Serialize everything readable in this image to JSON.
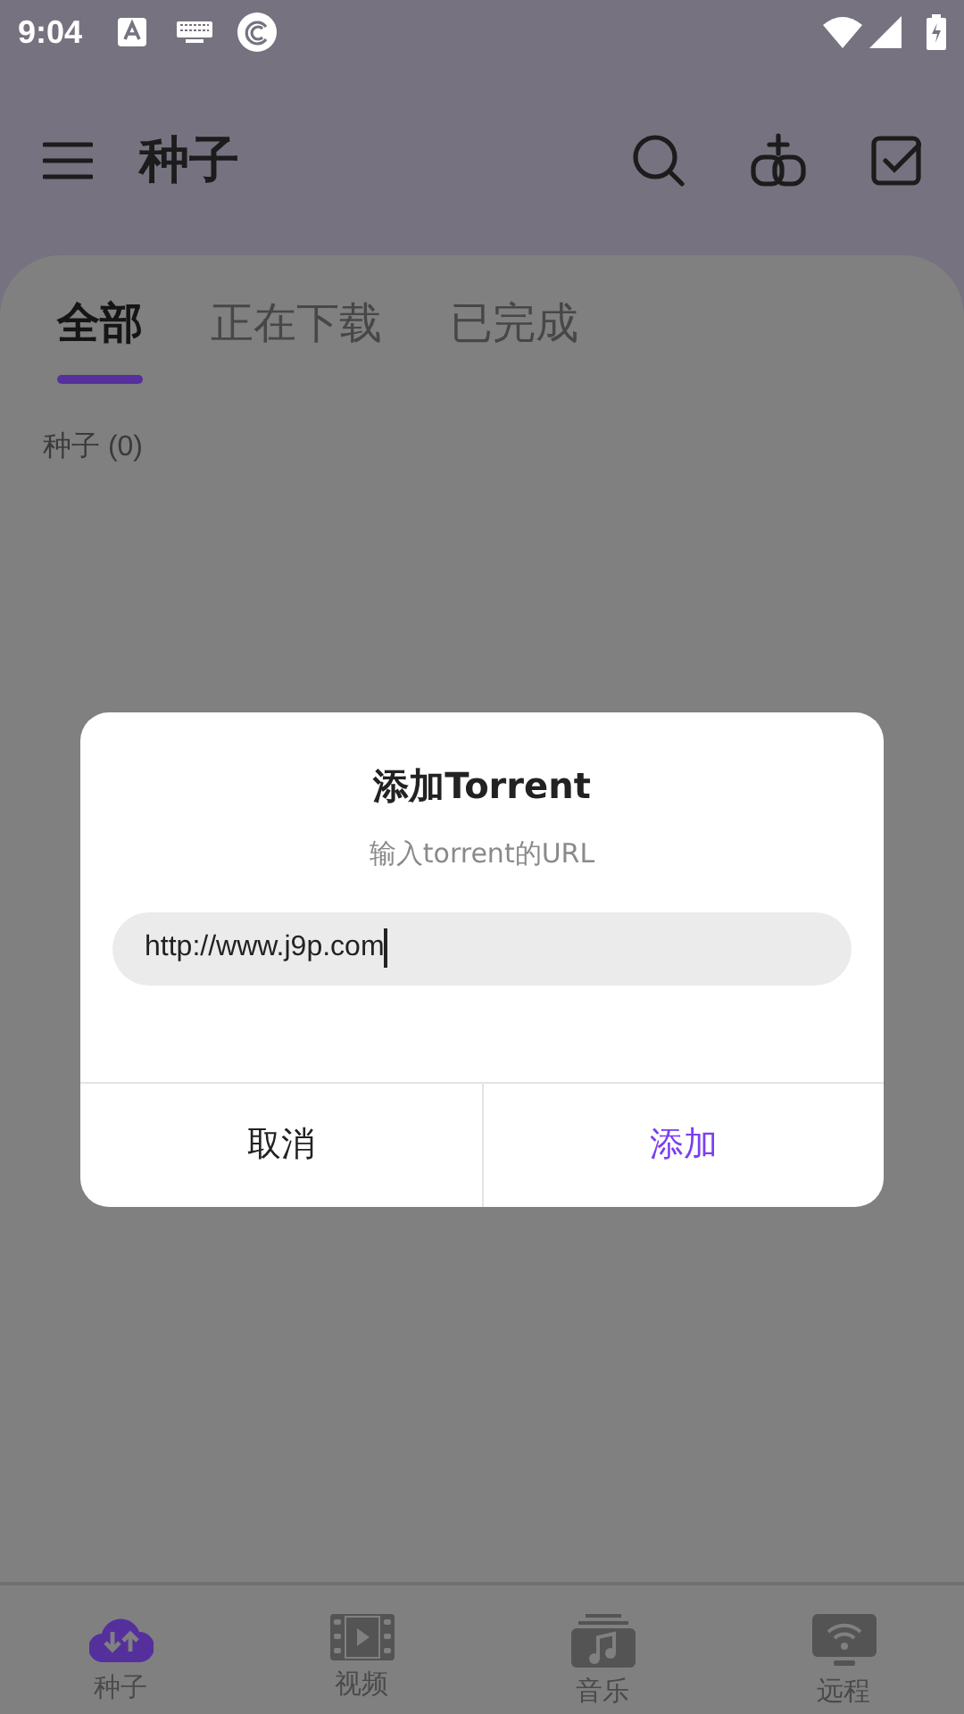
{
  "status_bar": {
    "time": "9:04"
  },
  "app_bar": {
    "title": "种子"
  },
  "tabs": [
    {
      "label": "全部",
      "selected": true
    },
    {
      "label": "正在下载",
      "selected": false
    },
    {
      "label": "已完成",
      "selected": false
    }
  ],
  "list_header": "种子 (0)",
  "dialog": {
    "title": "添加Torrent",
    "subtitle": "输入torrent的URL",
    "input": {
      "value": "http://www.j9p.com",
      "focused": true
    },
    "buttons": [
      {
        "label": "取消",
        "kind": "cancel"
      },
      {
        "label": "添加",
        "kind": "primary"
      }
    ]
  },
  "bottom_nav": [
    {
      "label": "种子",
      "kind": "torrent",
      "selected": true
    },
    {
      "label": "视频",
      "kind": "video",
      "selected": false
    },
    {
      "label": "音乐",
      "kind": "music",
      "selected": false
    },
    {
      "label": "远程",
      "kind": "remote",
      "selected": false
    }
  ]
}
